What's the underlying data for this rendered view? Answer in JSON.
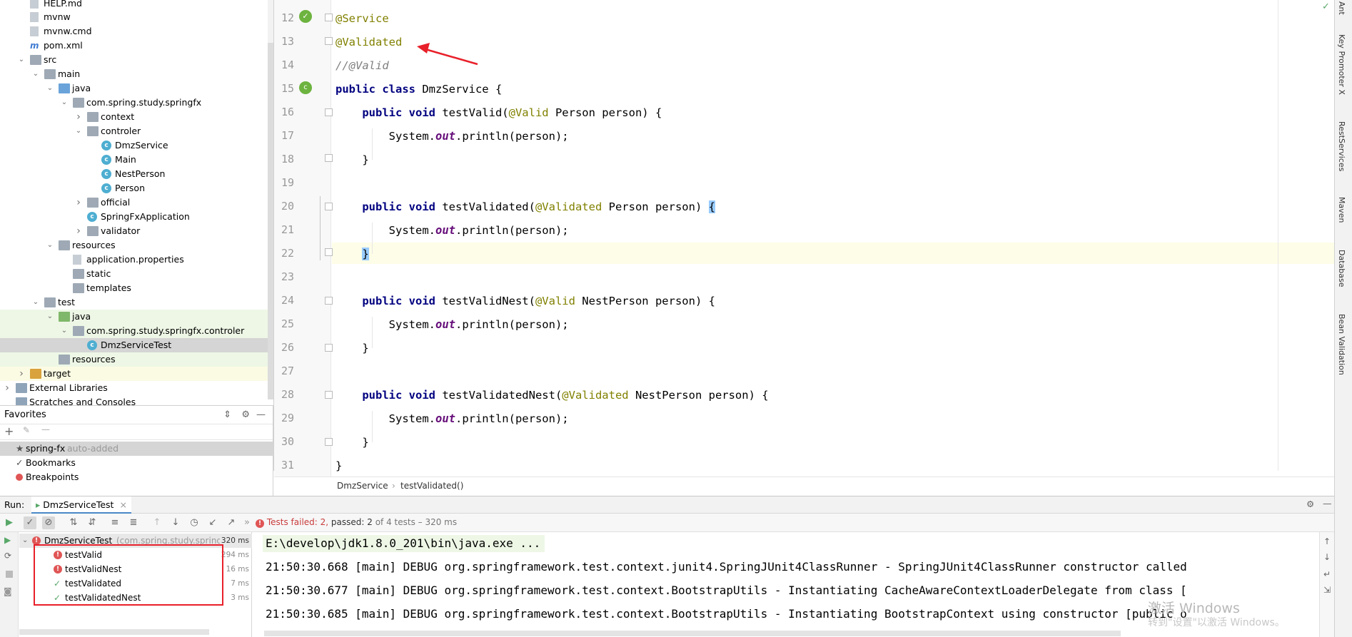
{
  "project_tree": [
    {
      "label": "HELP.md",
      "icon": "markdown-file-icon",
      "kind": "file"
    },
    {
      "label": "mvnw",
      "icon": "file-icon",
      "kind": "file"
    },
    {
      "label": "mvnw.cmd",
      "icon": "file-icon",
      "kind": "file"
    },
    {
      "label": "pom.xml",
      "icon": "maven-file-icon",
      "kind": "mfile"
    },
    {
      "label": "src",
      "icon": "folder-icon",
      "kind": "folder"
    },
    {
      "label": "main",
      "icon": "folder-icon",
      "kind": "folder"
    },
    {
      "label": "java",
      "icon": "source-folder-icon",
      "kind": "folder-blue"
    },
    {
      "label": "com.spring.study.springfx",
      "icon": "package-icon",
      "kind": "package"
    },
    {
      "label": "context",
      "icon": "package-icon",
      "kind": "package"
    },
    {
      "label": "controler",
      "icon": "package-icon",
      "kind": "package"
    },
    {
      "label": "DmzService",
      "icon": "class-icon",
      "kind": "class"
    },
    {
      "label": "Main",
      "icon": "class-icon",
      "kind": "class"
    },
    {
      "label": "NestPerson",
      "icon": "class-icon",
      "kind": "class"
    },
    {
      "label": "Person",
      "icon": "class-icon",
      "kind": "class"
    },
    {
      "label": "official",
      "icon": "package-icon",
      "kind": "package"
    },
    {
      "label": "SpringFxApplication",
      "icon": "spring-class-icon",
      "kind": "class"
    },
    {
      "label": "validator",
      "icon": "package-icon",
      "kind": "package"
    },
    {
      "label": "resources",
      "icon": "resources-folder-icon",
      "kind": "folder"
    },
    {
      "label": "application.properties",
      "icon": "properties-file-icon",
      "kind": "file"
    },
    {
      "label": "static",
      "icon": "folder-icon",
      "kind": "folder"
    },
    {
      "label": "templates",
      "icon": "folder-icon",
      "kind": "folder"
    },
    {
      "label": "test",
      "icon": "folder-icon",
      "kind": "folder"
    },
    {
      "label": "java",
      "icon": "test-folder-icon",
      "kind": "folder-green"
    },
    {
      "label": "com.spring.study.springfx.controler",
      "icon": "package-icon",
      "kind": "package"
    },
    {
      "label": "DmzServiceTest",
      "icon": "class-icon",
      "kind": "class"
    },
    {
      "label": "resources",
      "icon": "test-resources-folder-icon",
      "kind": "folder"
    },
    {
      "label": "target",
      "icon": "excluded-folder-icon",
      "kind": "folder-orange"
    },
    {
      "label": "External Libraries",
      "icon": "libraries-icon",
      "kind": "lib"
    },
    {
      "label": "Scratches and Consoles",
      "icon": "scratches-icon",
      "kind": "lib"
    }
  ],
  "favorites": {
    "title": "Favorites",
    "items": [
      {
        "label": "spring-fx",
        "suffix": "auto-added"
      },
      {
        "label": "Bookmarks",
        "suffix": ""
      },
      {
        "label": "Breakpoints",
        "suffix": ""
      }
    ]
  },
  "editor": {
    "lines": [
      {
        "n": "12"
      },
      {
        "n": "13"
      },
      {
        "n": "14"
      },
      {
        "n": "15"
      },
      {
        "n": "16"
      },
      {
        "n": "17"
      },
      {
        "n": "18"
      },
      {
        "n": "19"
      },
      {
        "n": "20"
      },
      {
        "n": "21"
      },
      {
        "n": "22"
      },
      {
        "n": "23"
      },
      {
        "n": "24"
      },
      {
        "n": "25"
      },
      {
        "n": "26"
      },
      {
        "n": "27"
      },
      {
        "n": "28"
      },
      {
        "n": "29"
      },
      {
        "n": "30"
      },
      {
        "n": "31"
      }
    ],
    "code": {
      "l12": "@Service",
      "l13": "@Validated",
      "l14": "//@Valid",
      "l15_kw": "public class",
      "l15_rest": " DmzService {",
      "kw_pv": "public void",
      "l16_name": " testValid(",
      "l16_ann": "@Valid",
      "l16_rest": " Person person) {",
      "sys": "System.",
      "out": "out",
      "println": ".println(person);",
      "close": "}",
      "l20_name": " testValidated(",
      "l20_ann": "@Validated",
      "l20_rest": " Person person) ",
      "open": "{",
      "l24_name": " testValidNest(",
      "l24_ann": "@Valid",
      "l24_rest": " NestPerson person) {",
      "l28_name": " testValidatedNest(",
      "l28_ann": "@Validated",
      "l28_rest": " NestPerson person) {"
    },
    "breadcrumb": [
      "DmzService",
      "testValidated()"
    ]
  },
  "right_tabs": [
    "Ant",
    "Key Promoter X",
    "RestServices",
    "Maven",
    "Database",
    "Bean Validation"
  ],
  "run": {
    "label": "Run:",
    "tab": "DmzServiceTest",
    "status_failed": "Tests failed: 2,",
    "status_passed": "passed: 2",
    "status_rest": "of 4 tests – 320 ms",
    "root": {
      "label": "DmzServiceTest",
      "pkg": "(com.spring.study.springf",
      "time": "320 ms"
    },
    "tests": [
      {
        "name": "testValid",
        "time": "294 ms",
        "status": "failed"
      },
      {
        "name": "testValidNest",
        "time": "16 ms",
        "status": "failed"
      },
      {
        "name": "testValidated",
        "time": "7 ms",
        "status": "passed"
      },
      {
        "name": "testValidatedNest",
        "time": "3 ms",
        "status": "passed"
      }
    ],
    "console": [
      "E:\\develop\\jdk1.8.0_201\\bin\\java.exe ...",
      "21:50:30.668 [main] DEBUG org.springframework.test.context.junit4.SpringJUnit4ClassRunner - SpringJUnit4ClassRunner constructor called",
      "21:50:30.677 [main] DEBUG org.springframework.test.context.BootstrapUtils - Instantiating CacheAwareContextLoaderDelegate from class [",
      "21:50:30.685 [main] DEBUG org.springframework.test.context.BootstrapUtils - Instantiating BootstrapContext using constructor [public o"
    ]
  },
  "watermark": {
    "line1": "激活 Windows",
    "line2": "转到\"设置\"以激活 Windows。"
  },
  "colors": {
    "fail": "#e05555",
    "pass": "#59a869",
    "annotation_arrow": "#e8202a",
    "highlight_box": "#e8202a"
  }
}
